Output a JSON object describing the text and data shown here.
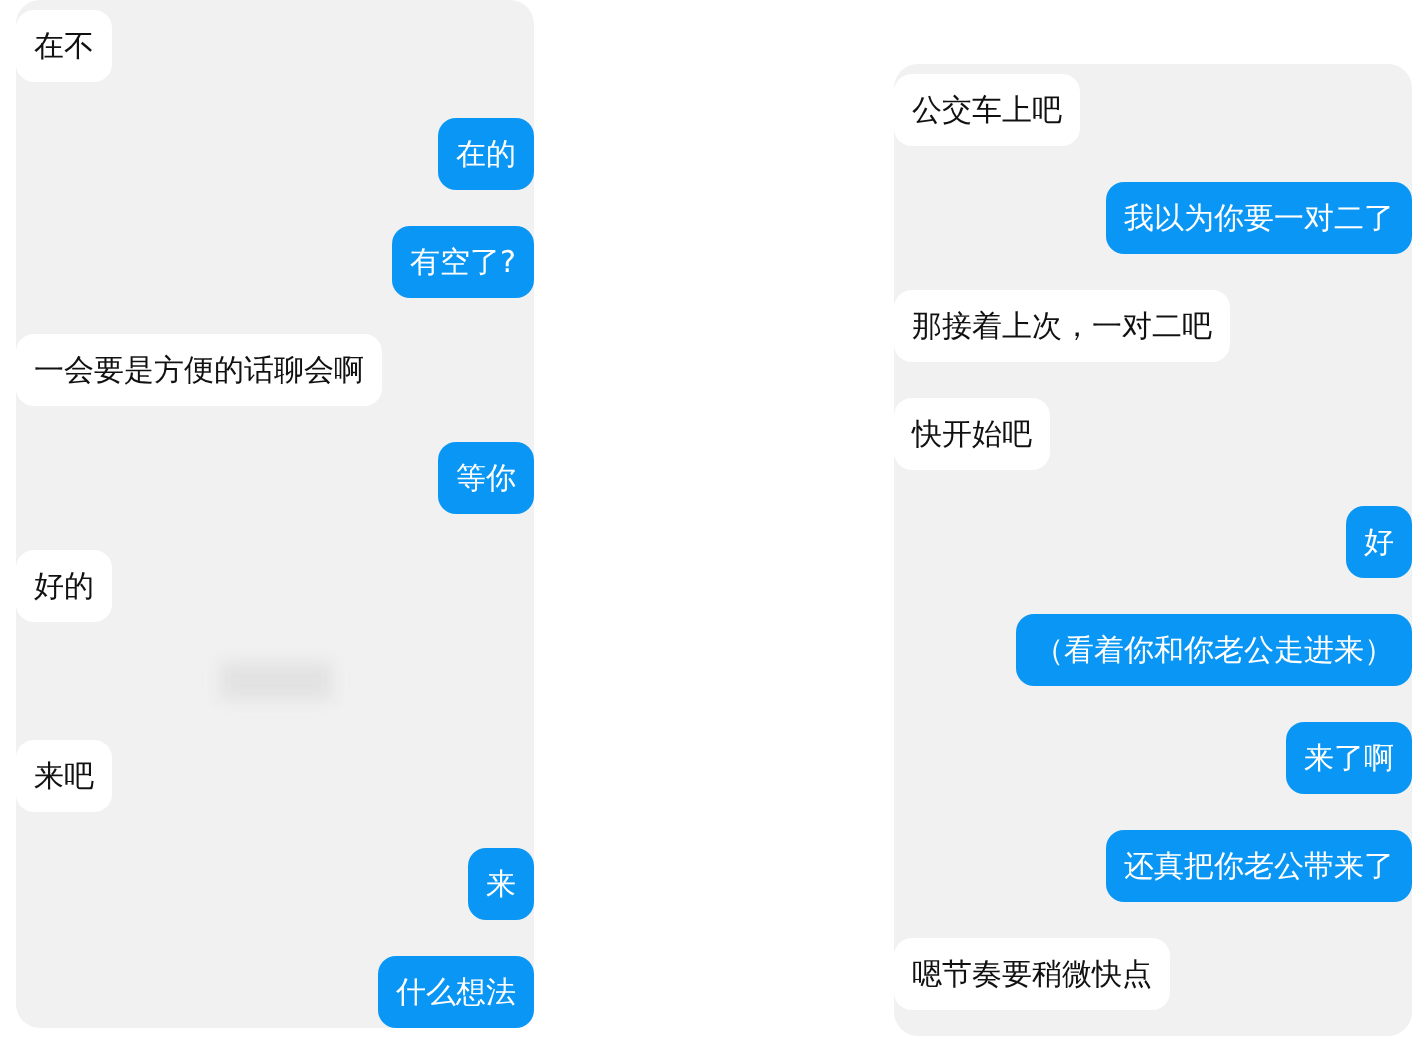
{
  "left_chat": {
    "messages": [
      {
        "kind": "received",
        "text": "在不"
      },
      {
        "kind": "sent",
        "text": "在的"
      },
      {
        "kind": "sent",
        "text": "有空了?"
      },
      {
        "kind": "received",
        "text": "一会要是方便的话聊会啊"
      },
      {
        "kind": "sent",
        "text": "等你"
      },
      {
        "kind": "received",
        "text": "好的"
      },
      {
        "kind": "blurred"
      },
      {
        "kind": "received",
        "text": "来吧"
      },
      {
        "kind": "sent",
        "text": "来"
      },
      {
        "kind": "sent",
        "text": "什么想法"
      }
    ]
  },
  "right_chat": {
    "messages": [
      {
        "kind": "received",
        "text": "公交车上吧"
      },
      {
        "kind": "sent",
        "text": "我以为你要一对二了"
      },
      {
        "kind": "received",
        "text": "那接着上次，一对二吧"
      },
      {
        "kind": "received",
        "text": "快开始吧"
      },
      {
        "kind": "sent",
        "text": "好"
      },
      {
        "kind": "sent",
        "text": "（看着你和你老公走进来）"
      },
      {
        "kind": "sent",
        "text": "来了啊"
      },
      {
        "kind": "sent",
        "text": "还真把你老公带来了"
      },
      {
        "kind": "received",
        "text": "嗯节奏要稍微快点"
      }
    ]
  }
}
